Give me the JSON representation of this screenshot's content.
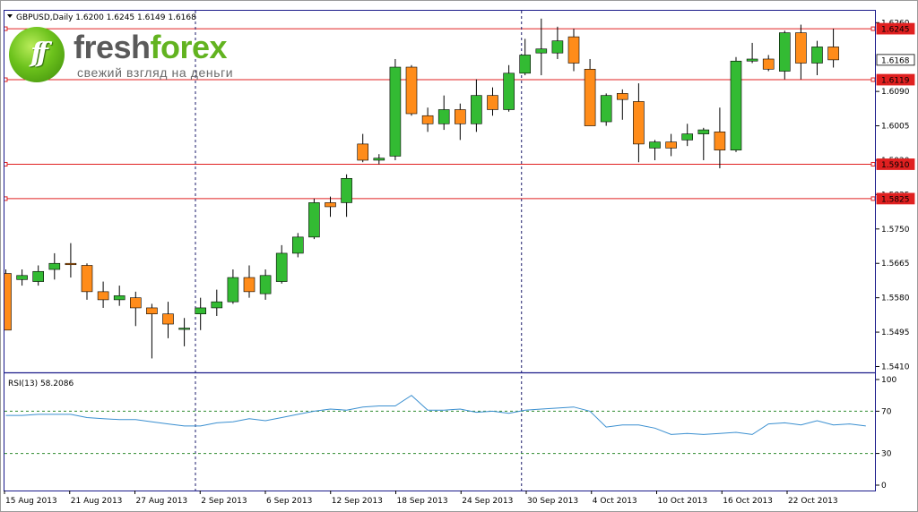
{
  "info": {
    "symbol_line": "GBPUSD,Daily  1.6200 1.6245 1.6149 1.6168",
    "rsi_line": "RSI(13) 58.2086"
  },
  "logo": {
    "mark": "ff",
    "word_a": "fresh",
    "word_b": "forex",
    "tagline": "свежий взгляд на деньги"
  },
  "colors": {
    "bull": "#33bb33",
    "bear": "#ff8c1a",
    "level_line": "#e02020",
    "rsi_line": "#3a8fd0",
    "rsi_levels": "#2e8b2e",
    "grid_separator": "#1a1a8a",
    "frame": "#1a1a8a"
  },
  "chart_data": [
    {
      "type": "candlestick",
      "symbol": "GBPUSD",
      "timeframe": "Daily",
      "ohlc_header": {
        "open": 1.62,
        "high": 1.6245,
        "low": 1.6149,
        "close": 1.6168
      },
      "y_ticks": [
        "1.6260",
        "1.6090",
        "1.6005",
        "1.5920",
        "1.5835",
        "1.5750",
        "1.5665",
        "1.5580",
        "1.5495",
        "1.5410"
      ],
      "ylim": [
        1.54,
        1.6285
      ],
      "price_labels": [
        {
          "value": 1.6245,
          "text": "1.6245",
          "kind": "level"
        },
        {
          "value": 1.6168,
          "text": "1.6168",
          "kind": "current"
        },
        {
          "value": 1.6119,
          "text": "1.6119",
          "kind": "level"
        },
        {
          "value": 1.591,
          "text": "1.5910",
          "kind": "level"
        },
        {
          "value": 1.5825,
          "text": "1.5825",
          "kind": "level"
        }
      ],
      "horizontal_levels": [
        1.6245,
        1.6119,
        1.591,
        1.5825
      ],
      "x_labels": [
        "15 Aug 2013",
        "21 Aug 2013",
        "27 Aug 2013",
        "2 Sep 2013",
        "6 Sep 2013",
        "12 Sep 2013",
        "18 Sep 2013",
        "24 Sep 2013",
        "30 Sep 2013",
        "4 Oct 2013",
        "10 Oct 2013",
        "16 Oct 2013",
        "22 Oct 2013"
      ],
      "vertical_markers": [
        "2 Sep 2013",
        "30 Sep 2013"
      ],
      "candles": [
        {
          "o": 1.564,
          "h": 1.565,
          "l": 1.55,
          "c": 1.55
        },
        {
          "o": 1.5625,
          "h": 1.565,
          "l": 1.561,
          "c": 1.5635
        },
        {
          "o": 1.562,
          "h": 1.566,
          "l": 1.561,
          "c": 1.5645
        },
        {
          "o": 1.565,
          "h": 1.569,
          "l": 1.5625,
          "c": 1.5665
        },
        {
          "o": 1.5665,
          "h": 1.5715,
          "l": 1.563,
          "c": 1.5662
        },
        {
          "o": 1.566,
          "h": 1.5665,
          "l": 1.5575,
          "c": 1.5595
        },
        {
          "o": 1.5595,
          "h": 1.562,
          "l": 1.5555,
          "c": 1.5575
        },
        {
          "o": 1.5575,
          "h": 1.561,
          "l": 1.556,
          "c": 1.5585
        },
        {
          "o": 1.558,
          "h": 1.5595,
          "l": 1.551,
          "c": 1.5555
        },
        {
          "o": 1.5555,
          "h": 1.5565,
          "l": 1.543,
          "c": 1.554
        },
        {
          "o": 1.554,
          "h": 1.557,
          "l": 1.548,
          "c": 1.5515
        },
        {
          "o": 1.5505,
          "h": 1.553,
          "l": 1.546,
          "c": 1.5505
        },
        {
          "o": 1.554,
          "h": 1.558,
          "l": 1.55,
          "c": 1.5555
        },
        {
          "o": 1.5555,
          "h": 1.56,
          "l": 1.5535,
          "c": 1.557
        },
        {
          "o": 1.557,
          "h": 1.565,
          "l": 1.5565,
          "c": 1.563
        },
        {
          "o": 1.563,
          "h": 1.566,
          "l": 1.558,
          "c": 1.5595
        },
        {
          "o": 1.559,
          "h": 1.565,
          "l": 1.5575,
          "c": 1.5635
        },
        {
          "o": 1.562,
          "h": 1.571,
          "l": 1.5615,
          "c": 1.569
        },
        {
          "o": 1.569,
          "h": 1.574,
          "l": 1.568,
          "c": 1.573
        },
        {
          "o": 1.573,
          "h": 1.5825,
          "l": 1.5725,
          "c": 1.5815
        },
        {
          "o": 1.5815,
          "h": 1.583,
          "l": 1.578,
          "c": 1.5805
        },
        {
          "o": 1.5815,
          "h": 1.5885,
          "l": 1.578,
          "c": 1.5875
        },
        {
          "o": 1.596,
          "h": 1.5985,
          "l": 1.5915,
          "c": 1.592
        },
        {
          "o": 1.592,
          "h": 1.5935,
          "l": 1.591,
          "c": 1.5925
        },
        {
          "o": 1.593,
          "h": 1.617,
          "l": 1.592,
          "c": 1.615
        },
        {
          "o": 1.615,
          "h": 1.6155,
          "l": 1.603,
          "c": 1.6035
        },
        {
          "o": 1.603,
          "h": 1.605,
          "l": 1.599,
          "c": 1.601
        },
        {
          "o": 1.601,
          "h": 1.608,
          "l": 1.5995,
          "c": 1.6045
        },
        {
          "o": 1.6045,
          "h": 1.606,
          "l": 1.597,
          "c": 1.601
        },
        {
          "o": 1.601,
          "h": 1.612,
          "l": 1.599,
          "c": 1.608
        },
        {
          "o": 1.608,
          "h": 1.61,
          "l": 1.603,
          "c": 1.6045
        },
        {
          "o": 1.6045,
          "h": 1.6155,
          "l": 1.604,
          "c": 1.6135
        },
        {
          "o": 1.6135,
          "h": 1.622,
          "l": 1.613,
          "c": 1.618
        },
        {
          "o": 1.6185,
          "h": 1.627,
          "l": 1.613,
          "c": 1.6195
        },
        {
          "o": 1.6185,
          "h": 1.625,
          "l": 1.617,
          "c": 1.6215
        },
        {
          "o": 1.6225,
          "h": 1.6245,
          "l": 1.614,
          "c": 1.616
        },
        {
          "o": 1.6145,
          "h": 1.617,
          "l": 1.6005,
          "c": 1.6005
        },
        {
          "o": 1.6015,
          "h": 1.6085,
          "l": 1.6005,
          "c": 1.608
        },
        {
          "o": 1.6085,
          "h": 1.6095,
          "l": 1.602,
          "c": 1.607
        },
        {
          "o": 1.6065,
          "h": 1.611,
          "l": 1.5915,
          "c": 1.596
        },
        {
          "o": 1.595,
          "h": 1.597,
          "l": 1.592,
          "c": 1.5965
        },
        {
          "o": 1.5965,
          "h": 1.5985,
          "l": 1.593,
          "c": 1.595
        },
        {
          "o": 1.597,
          "h": 1.601,
          "l": 1.5955,
          "c": 1.5985
        },
        {
          "o": 1.5985,
          "h": 1.6,
          "l": 1.592,
          "c": 1.5995
        },
        {
          "o": 1.599,
          "h": 1.605,
          "l": 1.59,
          "c": 1.5945
        },
        {
          "o": 1.5945,
          "h": 1.6175,
          "l": 1.594,
          "c": 1.6165
        },
        {
          "o": 1.6165,
          "h": 1.621,
          "l": 1.616,
          "c": 1.617
        },
        {
          "o": 1.617,
          "h": 1.618,
          "l": 1.614,
          "c": 1.6145
        },
        {
          "o": 1.614,
          "h": 1.624,
          "l": 1.612,
          "c": 1.6235
        },
        {
          "o": 1.6235,
          "h": 1.6255,
          "l": 1.612,
          "c": 1.616
        },
        {
          "o": 1.616,
          "h": 1.6215,
          "l": 1.613,
          "c": 1.62
        },
        {
          "o": 1.62,
          "h": 1.6245,
          "l": 1.6149,
          "c": 1.6168
        }
      ]
    },
    {
      "type": "line",
      "indicator": "RSI(13)",
      "last_value": 58.2086,
      "ylim": [
        0,
        100
      ],
      "y_ticks": [
        "100",
        "70",
        "30",
        "0"
      ],
      "levels": [
        70,
        30
      ],
      "values": [
        66,
        66,
        67,
        67,
        67,
        64,
        63,
        62,
        62,
        60,
        58,
        56,
        56,
        59,
        60,
        63,
        61,
        64,
        67,
        70,
        72,
        71,
        74,
        75,
        75,
        85,
        71,
        71,
        72,
        69,
        70,
        68,
        71,
        72,
        73,
        74,
        70,
        55,
        57,
        57,
        54,
        48,
        49,
        48,
        49,
        50,
        48,
        58,
        59,
        57,
        61,
        57,
        58,
        56
      ]
    }
  ]
}
